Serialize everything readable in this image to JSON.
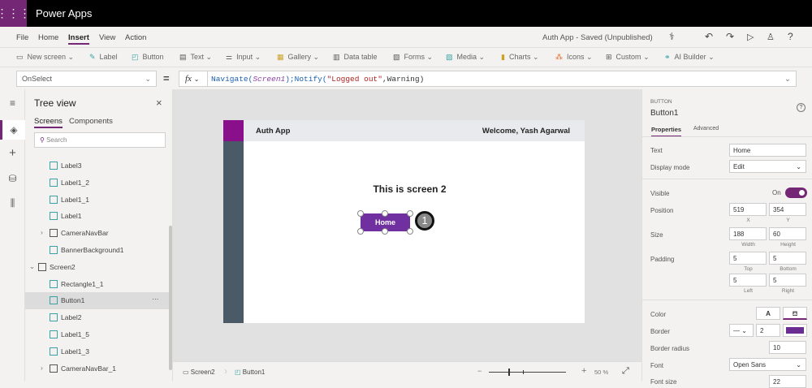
{
  "app": {
    "name": "Power Apps",
    "waffle_icon": "waffle-icon"
  },
  "menu": {
    "items": [
      "File",
      "Home",
      "Insert",
      "View",
      "Action"
    ],
    "active": "Insert",
    "doc_status": "Auth App - Saved (Unpublished)"
  },
  "toolbar": {
    "new_screen": "New screen",
    "label": "Label",
    "button": "Button",
    "text": "Text",
    "input": "Input",
    "gallery": "Gallery",
    "data_table": "Data table",
    "forms": "Forms",
    "media": "Media",
    "charts": "Charts",
    "icons": "Icons",
    "custom": "Custom",
    "ai_builder": "AI Builder"
  },
  "formula": {
    "property": "OnSelect",
    "equals": "=",
    "fx": "fx",
    "value": "Navigate(Screen1);Notify(\"Logged out\",Warning)",
    "parts": [
      "Navigate(",
      "Screen1",
      ");Notify(",
      "\"Logged out\"",
      ",Warning)"
    ]
  },
  "tree": {
    "title": "Tree view",
    "tabs": [
      "Screens",
      "Components"
    ],
    "search_placeholder": "Search",
    "items": [
      {
        "label": "Label3",
        "type": "label"
      },
      {
        "label": "Label1_2",
        "type": "label"
      },
      {
        "label": "Label1_1",
        "type": "label"
      },
      {
        "label": "Label1",
        "type": "label"
      },
      {
        "label": "CameraNavBar",
        "type": "group"
      },
      {
        "label": "BannerBackground1",
        "type": "shape"
      },
      {
        "label": "Screen2",
        "type": "screen"
      },
      {
        "label": "Rectangle1_1",
        "type": "shape"
      },
      {
        "label": "Button1",
        "type": "button",
        "selected": true
      },
      {
        "label": "Label2",
        "type": "label"
      },
      {
        "label": "Label1_5",
        "type": "label"
      },
      {
        "label": "Label1_3",
        "type": "label"
      },
      {
        "label": "CameraNavBar_1",
        "type": "group"
      }
    ]
  },
  "canvas": {
    "header_title": "Auth App",
    "welcome": "Welcome, Yash Agarwal",
    "heading": "This is screen 2",
    "button_text": "Home",
    "badge": "1",
    "colors": {
      "accent": "#8a0f8a",
      "sidebar": "#4a5a66",
      "button": "#7030a0"
    }
  },
  "status": {
    "screen": "Screen2",
    "control": "Button1",
    "zoom": "50",
    "zoom_unit": "%",
    "zoom_minus": "−",
    "zoom_plus": "+"
  },
  "props": {
    "type": "BUTTON",
    "name": "Button1",
    "tabs": [
      "Properties",
      "Advanced"
    ],
    "text_label": "Text",
    "text_value": "Home",
    "display_mode_label": "Display mode",
    "display_mode_value": "Edit",
    "visible_label": "Visible",
    "visible_value": "On",
    "position_label": "Position",
    "x": "519",
    "y": "354",
    "x_label": "X",
    "y_label": "Y",
    "size_label": "Size",
    "width": "188",
    "height": "60",
    "width_label": "Width",
    "height_label": "Height",
    "padding_label": "Padding",
    "pad_top": "5",
    "pad_bottom": "5",
    "pad_left": "5",
    "pad_right": "5",
    "top_label": "Top",
    "bottom_label": "Bottom",
    "left_label": "Left",
    "right_label": "Right",
    "color_label": "Color",
    "color_a": "A",
    "border_label": "Border",
    "border_width": "2",
    "border_color": "#6b2c91",
    "border_radius_label": "Border radius",
    "border_radius": "10",
    "font_label": "Font",
    "font_value": "Open Sans",
    "font_size_label": "Font size",
    "font_size": "22"
  }
}
